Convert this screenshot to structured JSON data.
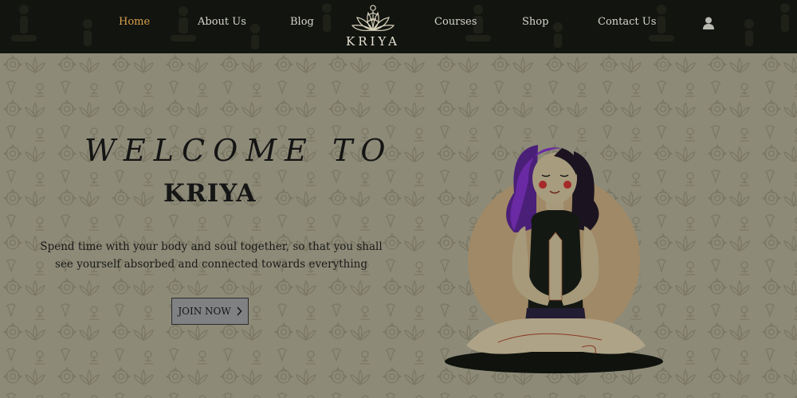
{
  "nav": {
    "items": [
      {
        "label": "Home",
        "active": true
      },
      {
        "label": "About Us",
        "active": false
      },
      {
        "label": "Blog",
        "active": false
      },
      {
        "label": "Courses",
        "active": false
      },
      {
        "label": "Shop",
        "active": false
      },
      {
        "label": "Contact Us",
        "active": false
      }
    ],
    "logo_text": "KRIYA",
    "user_icon": "user-icon"
  },
  "hero": {
    "welcome": "WELCOME TO",
    "brand": "KRIYA",
    "description": "Spend time with your body and soul together, so that you shall see yourself absorbed and connected towards everything",
    "cta_label": "JOIN NOW"
  },
  "colors": {
    "nav_bg": "#121410",
    "active_link": "#d9a24a",
    "hero_bg": "#8d8a78",
    "hair": "#6a2aa3"
  }
}
